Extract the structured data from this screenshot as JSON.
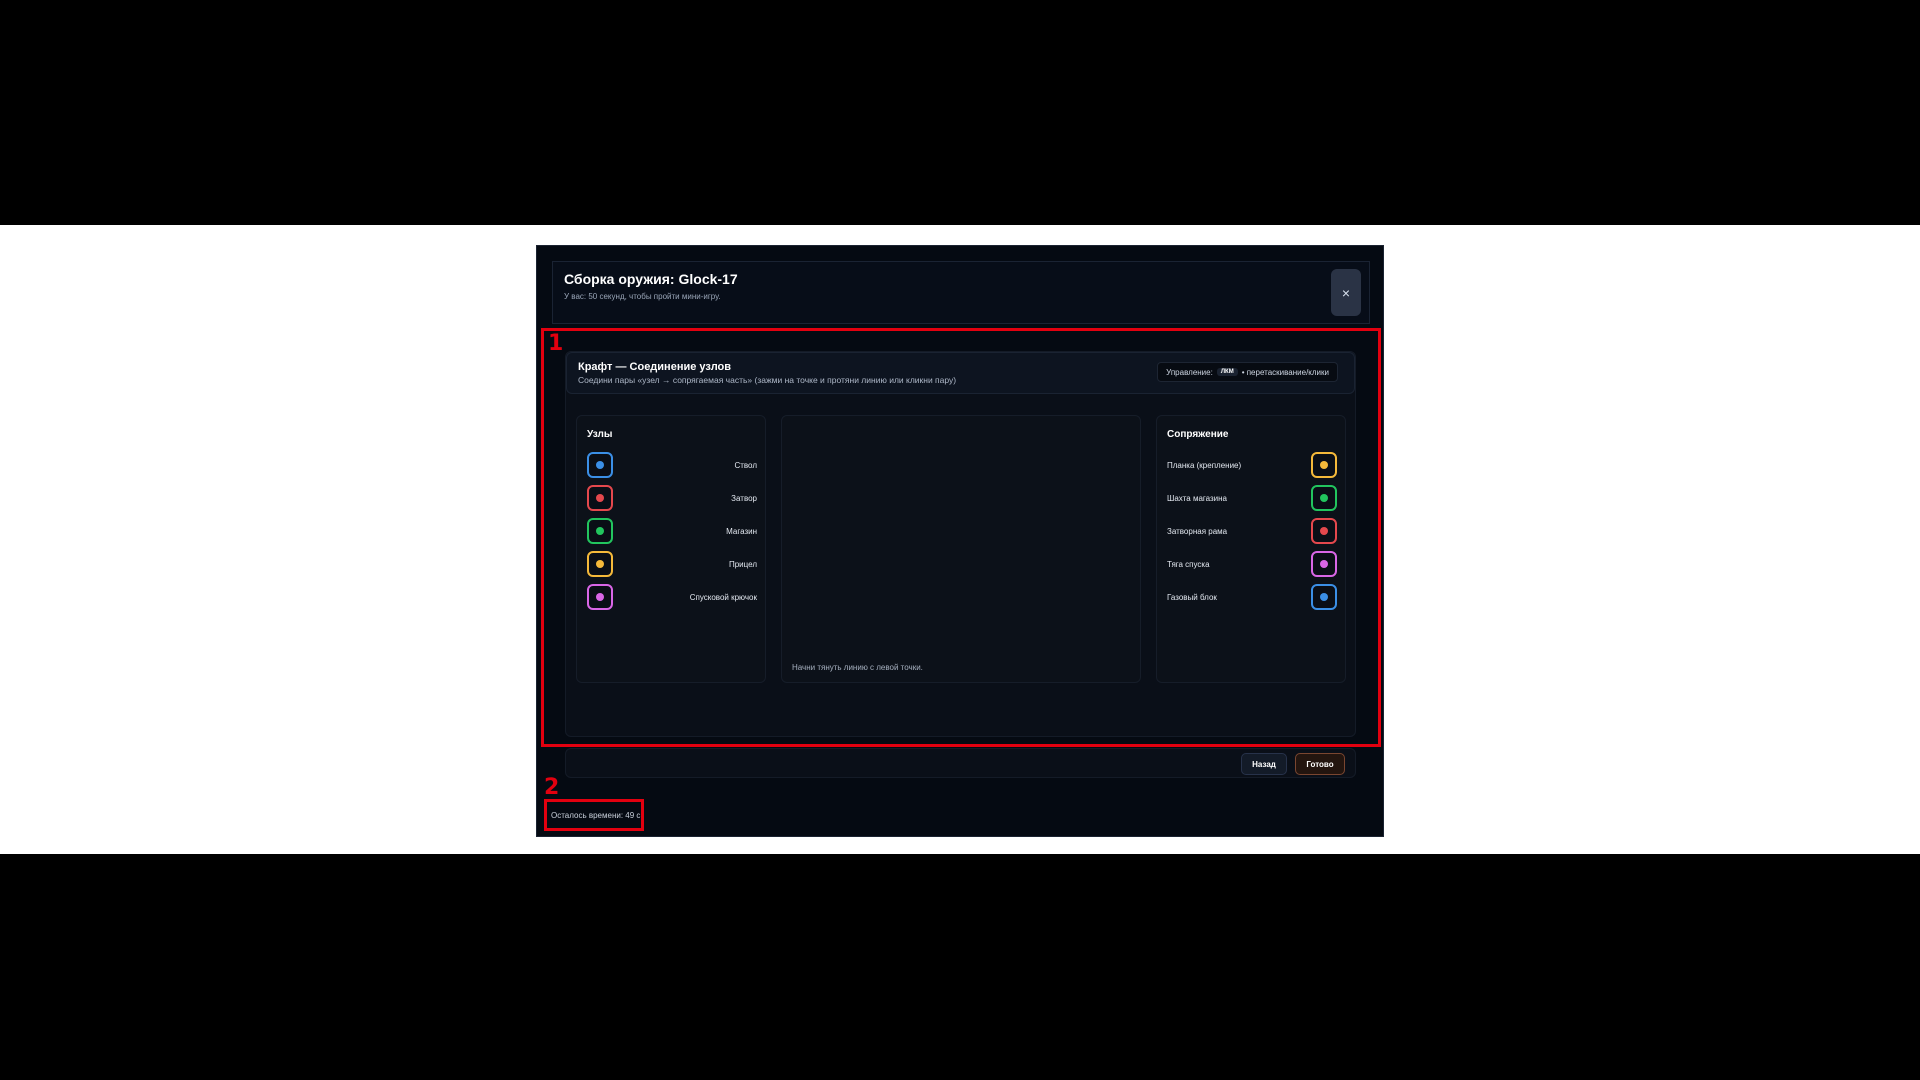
{
  "header": {
    "title": "Сборка оружия: Glock-17",
    "subtitle": "У вас: 50 секунд, чтобы пройти мини-игру.",
    "close_label": "×"
  },
  "annotations": {
    "label_1": "1",
    "label_2": "2"
  },
  "craft": {
    "title": "Крафт — Соединение узлов",
    "description": "Соедини пары «узел → сопрягаемая часть» (зажми на точке и протяни линию или кликни пару)",
    "controls_label": "Управление:",
    "controls_key": "ЛКМ",
    "controls_text": "• перетаскивание/клики"
  },
  "nodes": {
    "title": "Узлы",
    "items": [
      {
        "label": "Ствол",
        "color": "#3b8fe6"
      },
      {
        "label": "Затвор",
        "color": "#e5484d"
      },
      {
        "label": "Магазин",
        "color": "#22c55e"
      },
      {
        "label": "Прицел",
        "color": "#f5b93a"
      },
      {
        "label": "Спусковой крючок",
        "color": "#d966e6"
      }
    ]
  },
  "mates": {
    "title": "Сопряжение",
    "items": [
      {
        "label": "Планка (крепление)",
        "color": "#f5b93a"
      },
      {
        "label": "Шахта магазина",
        "color": "#22c55e"
      },
      {
        "label": "Затворная рама",
        "color": "#e5484d"
      },
      {
        "label": "Тяга спуска",
        "color": "#d966e6"
      },
      {
        "label": "Газовый блок",
        "color": "#3b8fe6"
      }
    ]
  },
  "canvas": {
    "hint": "Начни тянуть линию с левой точки."
  },
  "footer": {
    "back_label": "Назад",
    "done_label": "Готово"
  },
  "timer": {
    "text": "Осталось времени: 49 с"
  }
}
